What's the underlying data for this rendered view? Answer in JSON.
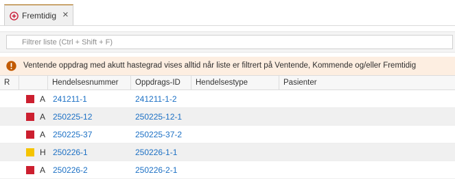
{
  "tab": {
    "label": "Fremtidig",
    "close": "×",
    "icon": "plus-circle-icon"
  },
  "filter": {
    "placeholder": "Filtrer liste (Ctrl + Shift + F)",
    "value": ""
  },
  "banner": {
    "icon": "warning-icon",
    "text": "Ventende oppdrag med akutt hastegrad vises alltid når liste er filtrert på Ventende, Kommende og/eller Fremtidig"
  },
  "table": {
    "columns": {
      "r": "R",
      "event_number": "Hendelsesnummer",
      "order_id": "Oppdrags-ID",
      "event_type": "Hendelsestype",
      "patients": "Pasienter"
    },
    "rows": [
      {
        "color": "#cc1f2f",
        "priority": "A",
        "event_number": "241211-1",
        "order_id": "241211-1-2",
        "event_type": "",
        "patients": ""
      },
      {
        "color": "#cc1f2f",
        "priority": "A",
        "event_number": "250225-12",
        "order_id": "250225-12-1",
        "event_type": "",
        "patients": ""
      },
      {
        "color": "#cc1f2f",
        "priority": "A",
        "event_number": "250225-37",
        "order_id": "250225-37-2",
        "event_type": "",
        "patients": ""
      },
      {
        "color": "#f5c400",
        "priority": "H",
        "event_number": "250226-1",
        "order_id": "250226-1-1",
        "event_type": "",
        "patients": ""
      },
      {
        "color": "#cc1f2f",
        "priority": "A",
        "event_number": "250226-2",
        "order_id": "250226-2-1",
        "event_type": "",
        "patients": ""
      }
    ]
  },
  "colors": {
    "accent": "#c9a46b",
    "link": "#1a6fc4",
    "banner_bg": "#fdeee1",
    "warning": "#c25a00",
    "tab_icon": "#c8102e"
  }
}
